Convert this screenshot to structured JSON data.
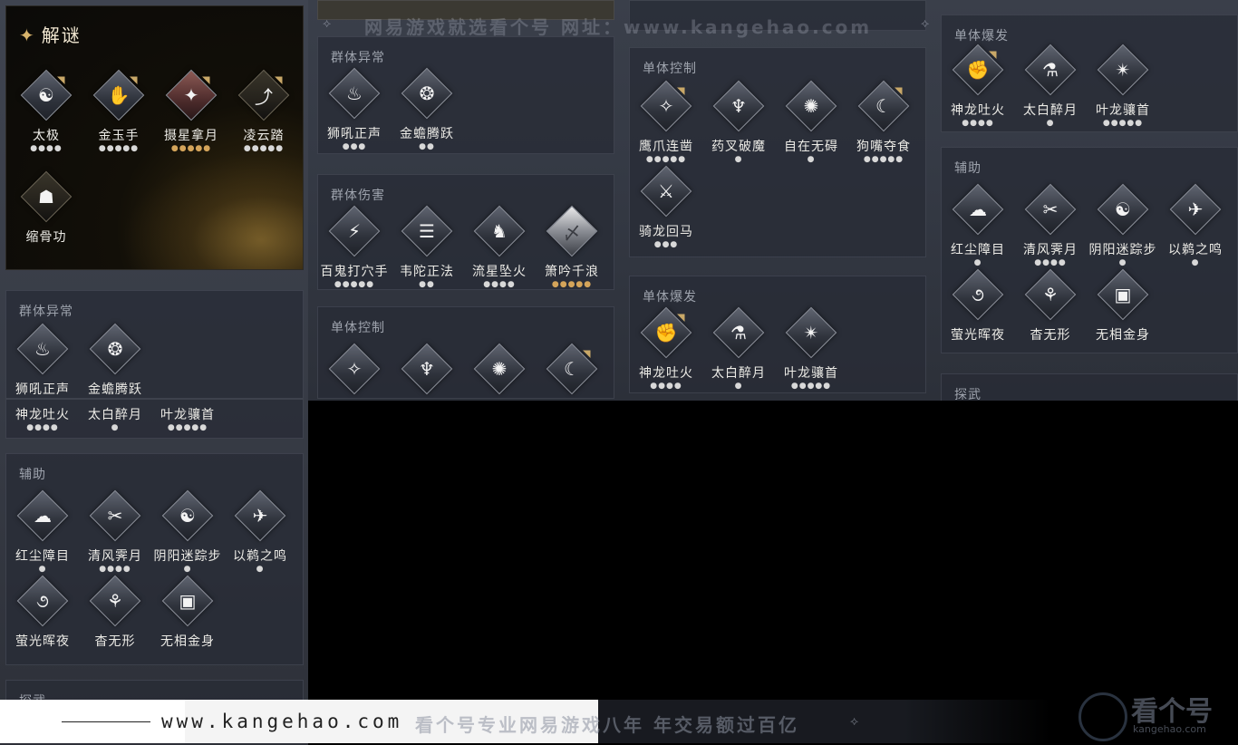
{
  "watermark": "网易游戏就选看个号  网址：www.kangehao.com",
  "footer": {
    "url": "www.kangehao.com",
    "slogan": "看个号专业网易游戏八年  年交易额过百亿",
    "brand_name": "看个号",
    "brand_url": "kangehao.com"
  },
  "left": {
    "puzzle": {
      "title": "解谜",
      "skills": [
        {
          "name": "太极",
          "dots": "●●●●",
          "glyph": "☯"
        },
        {
          "name": "金玉手",
          "dots": "●●●●●",
          "glyph": "✋"
        },
        {
          "name": "摄星拿月",
          "dots": "●●●●●",
          "glyph": "✦"
        },
        {
          "name": "凌云踏",
          "dots": "●●●●●",
          "glyph": "⤴"
        },
        {
          "name": "缩骨功",
          "dots": "",
          "glyph": "☗"
        }
      ]
    },
    "group_abnormal": {
      "title": "群体异常",
      "skills": [
        {
          "name": "狮吼正声",
          "dots": "●●●",
          "glyph": "♨"
        },
        {
          "name": "金蟾腾跃",
          "dots": "●●",
          "glyph": "❂"
        }
      ]
    },
    "burst_row": [
      {
        "name": "神龙吐火",
        "dots": "●●●●"
      },
      {
        "name": "太白醉月",
        "dots": "●"
      },
      {
        "name": "叶龙骧首",
        "dots": "●●●●●"
      }
    ],
    "assist": {
      "title": "辅助",
      "skills": [
        {
          "name": "红尘障目",
          "dots": "●",
          "glyph": "☁"
        },
        {
          "name": "清风霁月",
          "dots": "●●●●",
          "glyph": "✂"
        },
        {
          "name": "阴阳迷踪步",
          "dots": "●",
          "glyph": "☯"
        },
        {
          "name": "以鹈之鸣",
          "dots": "●",
          "glyph": "✈"
        },
        {
          "name": "萤光晖夜",
          "dots": "",
          "glyph": "૭"
        },
        {
          "name": "杳无形",
          "dots": "",
          "glyph": "⚘"
        },
        {
          "name": "无相金身",
          "dots": "",
          "glyph": "▣"
        }
      ]
    },
    "bottom_title": "探武"
  },
  "col2": {
    "top_cut": [
      {
        "name": "百鬼打穴手",
        "dots": "●●●●●"
      },
      {
        "name": "韦陀正法",
        "dots": "●●"
      },
      {
        "name": "流星坠火",
        "dots": "●●●●"
      },
      {
        "name": "箫吟千浪",
        "dots": "●●●●●"
      }
    ],
    "group_abnormal": {
      "title": "群体异常",
      "skills": [
        {
          "name": "狮吼正声",
          "dots": "●●●",
          "glyph": "♨"
        },
        {
          "name": "金蟾腾跃",
          "dots": "●●",
          "glyph": "❂"
        }
      ]
    },
    "group_damage": {
      "title": "群体伤害",
      "skills": [
        {
          "name": "百鬼打穴手",
          "dots": "●●●●●",
          "glyph": "⚡"
        },
        {
          "name": "韦陀正法",
          "dots": "●●",
          "glyph": "☰"
        },
        {
          "name": "流星坠火",
          "dots": "●●●●",
          "glyph": "♞"
        },
        {
          "name": "箫吟千浪",
          "dots": "●●●●●",
          "glyph": "〆"
        }
      ]
    },
    "single_control": {
      "title": "单体控制"
    }
  },
  "col3": {
    "single_control": {
      "title": "单体控制",
      "skills": [
        {
          "name": "鹰爪连凿",
          "dots": "●●●●●",
          "glyph": "✧"
        },
        {
          "name": "药叉破魔",
          "dots": "●",
          "glyph": "♆"
        },
        {
          "name": "自在无碍",
          "dots": "●",
          "glyph": "✺"
        },
        {
          "name": "狗嘴夺食",
          "dots": "●●●●●",
          "glyph": "☾"
        },
        {
          "name": "骑龙回马",
          "dots": "●●●",
          "glyph": "⚔"
        }
      ]
    },
    "single_burst": {
      "title": "单体爆发",
      "skills": [
        {
          "name": "神龙吐火",
          "dots": "●●●●",
          "glyph": "✊"
        },
        {
          "name": "太白醉月",
          "dots": "●",
          "glyph": "⚗"
        },
        {
          "name": "叶龙骧首",
          "dots": "●●●●●",
          "glyph": "✴"
        }
      ]
    }
  },
  "col4": {
    "single_burst": {
      "title": "单体爆发",
      "skills": [
        {
          "name": "神龙吐火",
          "dots": "●●●●",
          "glyph": "✊"
        },
        {
          "name": "太白醉月",
          "dots": "●",
          "glyph": "⚗"
        },
        {
          "name": "叶龙骧首",
          "dots": "●●●●●",
          "glyph": "✴"
        }
      ]
    },
    "assist": {
      "title": "辅助",
      "skills": [
        {
          "name": "红尘障目",
          "dots": "●",
          "glyph": "☁"
        },
        {
          "name": "清风霁月",
          "dots": "●●●●",
          "glyph": "✂"
        },
        {
          "name": "阴阳迷踪步",
          "dots": "●",
          "glyph": "☯"
        },
        {
          "name": "以鹈之鸣",
          "dots": "●",
          "glyph": "✈"
        },
        {
          "name": "萤光晖夜",
          "dots": "",
          "glyph": "૭"
        },
        {
          "name": "杳无形",
          "dots": "",
          "glyph": "⚘"
        },
        {
          "name": "无相金身",
          "dots": "",
          "glyph": "▣"
        }
      ]
    },
    "bottom_title": "探武"
  }
}
